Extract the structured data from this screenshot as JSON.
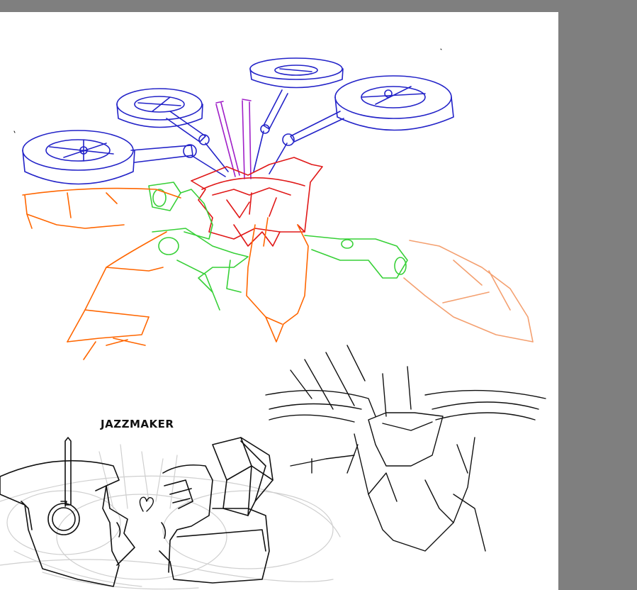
{
  "canvas": {
    "background": "#ffffff",
    "surround": "#7f7f7f",
    "caption": "JAZZMAKER"
  },
  "colors": {
    "rotors": "#2323c8",
    "antenna": "#a020c8",
    "head": "#e01818",
    "arms_green": "#37d037",
    "wings_orange": "#ff6600",
    "wing_right": "#f4a070",
    "ink": "#111111",
    "pencil": "#cfcfcf"
  }
}
